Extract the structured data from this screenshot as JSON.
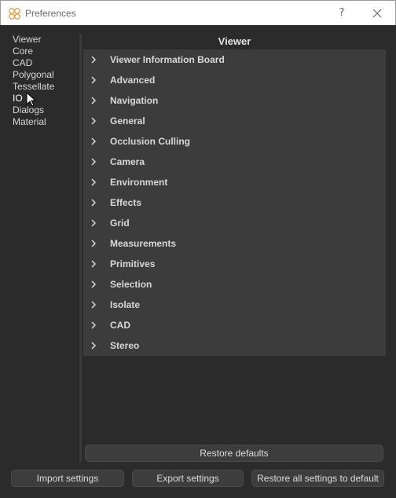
{
  "window": {
    "title": "Preferences",
    "help_label": "?"
  },
  "nav": {
    "items": [
      {
        "label": "Viewer"
      },
      {
        "label": "Core"
      },
      {
        "label": "CAD"
      },
      {
        "label": "Polygonal"
      },
      {
        "label": "Tessellate"
      },
      {
        "label": "IO"
      },
      {
        "label": "Dialogs"
      },
      {
        "label": "Material"
      }
    ],
    "hovered": "IO"
  },
  "panel": {
    "title": "Viewer",
    "sections": [
      {
        "label": "Viewer Information Board"
      },
      {
        "label": "Advanced"
      },
      {
        "label": "Navigation"
      },
      {
        "label": "General"
      },
      {
        "label": "Occlusion Culling"
      },
      {
        "label": "Camera"
      },
      {
        "label": "Environment"
      },
      {
        "label": "Effects"
      },
      {
        "label": "Grid"
      },
      {
        "label": "Measurements"
      },
      {
        "label": "Primitives"
      },
      {
        "label": "Selection"
      },
      {
        "label": "Isolate"
      },
      {
        "label": "CAD"
      },
      {
        "label": "Stereo"
      }
    ]
  },
  "buttons": {
    "restore_defaults": "Restore defaults",
    "import_settings": "Import settings",
    "export_settings": "Export settings",
    "restore_all": "Restore all settings to default"
  },
  "colors": {
    "background": "#2b2b2b",
    "section_bg": "#3c3c3c",
    "app_icon": "#e0a050"
  }
}
